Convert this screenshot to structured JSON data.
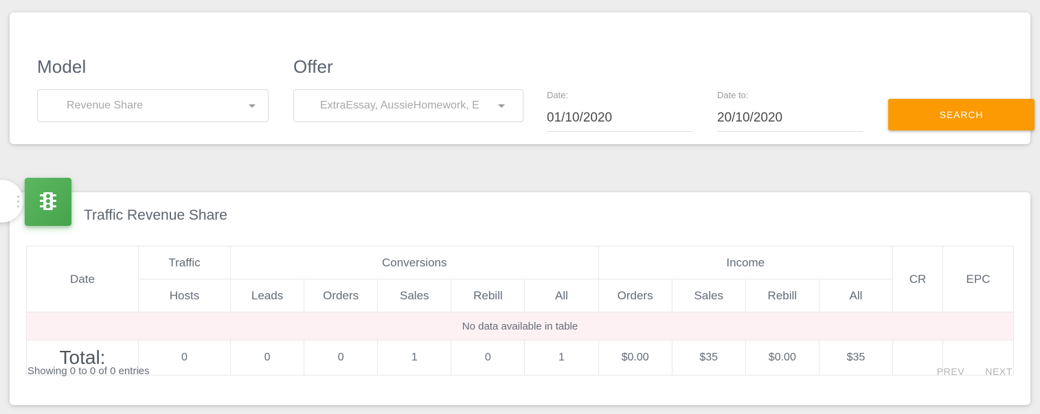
{
  "filters": {
    "model": {
      "label": "Model",
      "value": "Revenue Share",
      "caret_icon": "chevron-down-icon"
    },
    "offer": {
      "label": "Offer",
      "value": "ExtraEssay, AussieHomework, E",
      "caret_icon": "chevron-down-icon"
    },
    "date_from": {
      "label": "Date:",
      "value": "01/10/2020"
    },
    "date_to": {
      "label": "Date to:",
      "value": "20/10/2020"
    },
    "search_button": {
      "label": "SEARCH",
      "color": "#fb9a02"
    }
  },
  "report": {
    "badge_icon": "traffic-light-icon",
    "badge_color": "#4caf50",
    "title": "Traffic Revenue Share",
    "header_groups": {
      "date": "Date",
      "traffic": "Traffic",
      "conversions": "Conversions",
      "income": "Income",
      "cr": "CR",
      "epc": "EPC"
    },
    "header_sub": {
      "hosts": "Hosts",
      "conv_leads": "Leads",
      "conv_orders": "Orders",
      "conv_sales": "Sales",
      "conv_rebill": "Rebill",
      "conv_all": "All",
      "inc_orders": "Orders",
      "inc_sales": "Sales",
      "inc_rebill": "Rebill",
      "inc_all": "All"
    },
    "empty_message": "No data available in table",
    "empty_row_color": "#fdf1f3",
    "totals": {
      "label": "Total:",
      "hosts": "0",
      "conv_leads": "0",
      "conv_orders": "0",
      "conv_sales": "1",
      "conv_rebill": "0",
      "conv_all": "1",
      "inc_orders": "$0.00",
      "inc_sales": "$35",
      "inc_rebill": "$0.00",
      "inc_all": "$35",
      "cr": "",
      "epc": ""
    },
    "footer": {
      "showing": "Showing 0 to 0 of 0 entries",
      "prev": "PREV",
      "next": "NEXT"
    }
  }
}
